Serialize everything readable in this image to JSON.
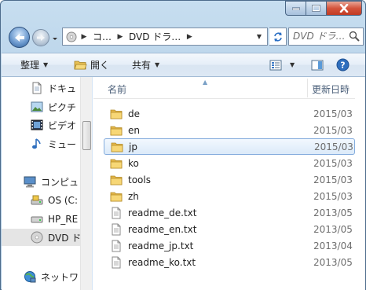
{
  "window": {
    "caption_buttons": [
      "minimize",
      "maximize",
      "close"
    ]
  },
  "address_bar": {
    "segments": [
      "コ…",
      "DVD ドラ…"
    ],
    "search_placeholder": "DVD ドラ…"
  },
  "command_bar": {
    "organize_label": "整理",
    "open_label": "開く",
    "share_label": "共有"
  },
  "nav_pane": {
    "items": [
      {
        "label": "ドキュ",
        "icon": "document-icon"
      },
      {
        "label": "ピクチ",
        "icon": "pictures-icon"
      },
      {
        "label": "ビデオ",
        "icon": "video-icon"
      },
      {
        "label": "ミュー",
        "icon": "music-icon"
      },
      {
        "label": "コンピュ",
        "icon": "computer-icon"
      },
      {
        "label": "OS (C:",
        "icon": "drive-c-icon"
      },
      {
        "label": "HP_RE",
        "icon": "drive-icon"
      },
      {
        "label": "DVD ド",
        "icon": "dvd-icon"
      },
      {
        "label": "ネットワ",
        "icon": "network-icon"
      }
    ]
  },
  "file_list": {
    "column_name": "名前",
    "column_date": "更新日時",
    "files": [
      {
        "name": "de",
        "date": "2015/03",
        "type": "folder"
      },
      {
        "name": "en",
        "date": "2015/03",
        "type": "folder"
      },
      {
        "name": "jp",
        "date": "2015/03",
        "type": "folder",
        "selected": true
      },
      {
        "name": "ko",
        "date": "2015/03",
        "type": "folder"
      },
      {
        "name": "tools",
        "date": "2015/03",
        "type": "folder"
      },
      {
        "name": "zh",
        "date": "2015/03",
        "type": "folder"
      },
      {
        "name": "readme_de.txt",
        "date": "2013/05",
        "type": "text"
      },
      {
        "name": "readme_en.txt",
        "date": "2013/05",
        "type": "text"
      },
      {
        "name": "readme_jp.txt",
        "date": "2013/04",
        "type": "text"
      },
      {
        "name": "readme_ko.txt",
        "date": "2013/05",
        "type": "text"
      }
    ]
  }
}
